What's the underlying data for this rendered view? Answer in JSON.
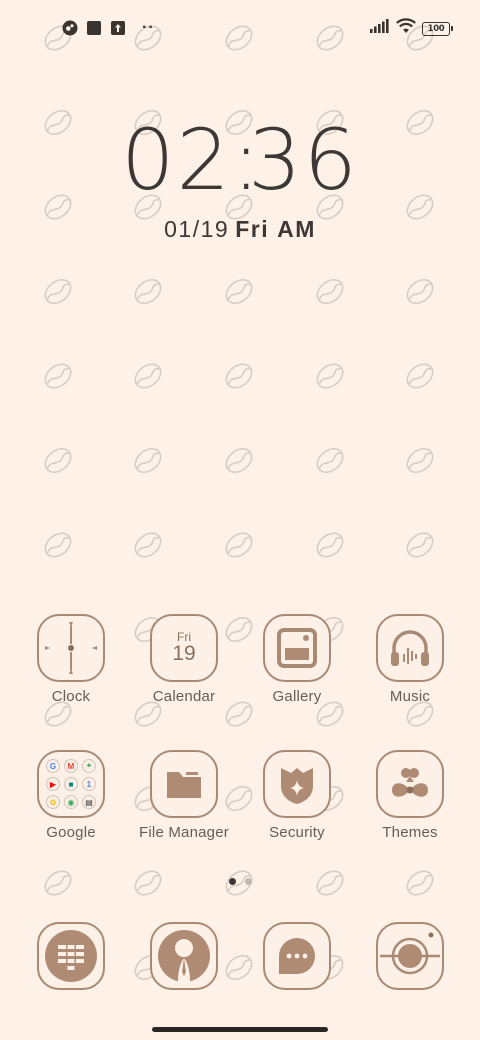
{
  "status_bar": {
    "left_icons": [
      "app-notification-icon",
      "square-notification-icon",
      "upload-icon",
      "more-dots-icon"
    ],
    "more_indicator": "··",
    "battery_level": "100",
    "signal_icon": "signal-bars-icon",
    "wifi_icon": "wifi-icon"
  },
  "clock": {
    "hour": "02",
    "separator": ":",
    "minute": "36",
    "date": "01/19",
    "weekday": "Fri",
    "ampm": "AM"
  },
  "apps": [
    {
      "label": "Clock",
      "icon": "clock-icon"
    },
    {
      "label": "Calendar",
      "icon": "calendar-icon",
      "day": "Fri",
      "date": "19"
    },
    {
      "label": "Gallery",
      "icon": "gallery-icon"
    },
    {
      "label": "Music",
      "icon": "headphones-icon"
    },
    {
      "label": "Google",
      "icon": "google-folder-icon"
    },
    {
      "label": "File Manager",
      "icon": "folder-icon"
    },
    {
      "label": "Security",
      "icon": "shield-icon"
    },
    {
      "label": "Themes",
      "icon": "bow-icon"
    }
  ],
  "dock": [
    {
      "icon": "phone-dialpad-icon"
    },
    {
      "icon": "contacts-icon"
    },
    {
      "icon": "messages-icon"
    },
    {
      "icon": "camera-icon"
    }
  ],
  "page_indicator": {
    "pages": 2,
    "active": 1
  },
  "colors": {
    "background": "#fdf1e8",
    "icon_outline": "#a98a74",
    "icon_fill": "#b08b74",
    "text": "#3d3835",
    "bean_outline": "#d9ccc2"
  }
}
